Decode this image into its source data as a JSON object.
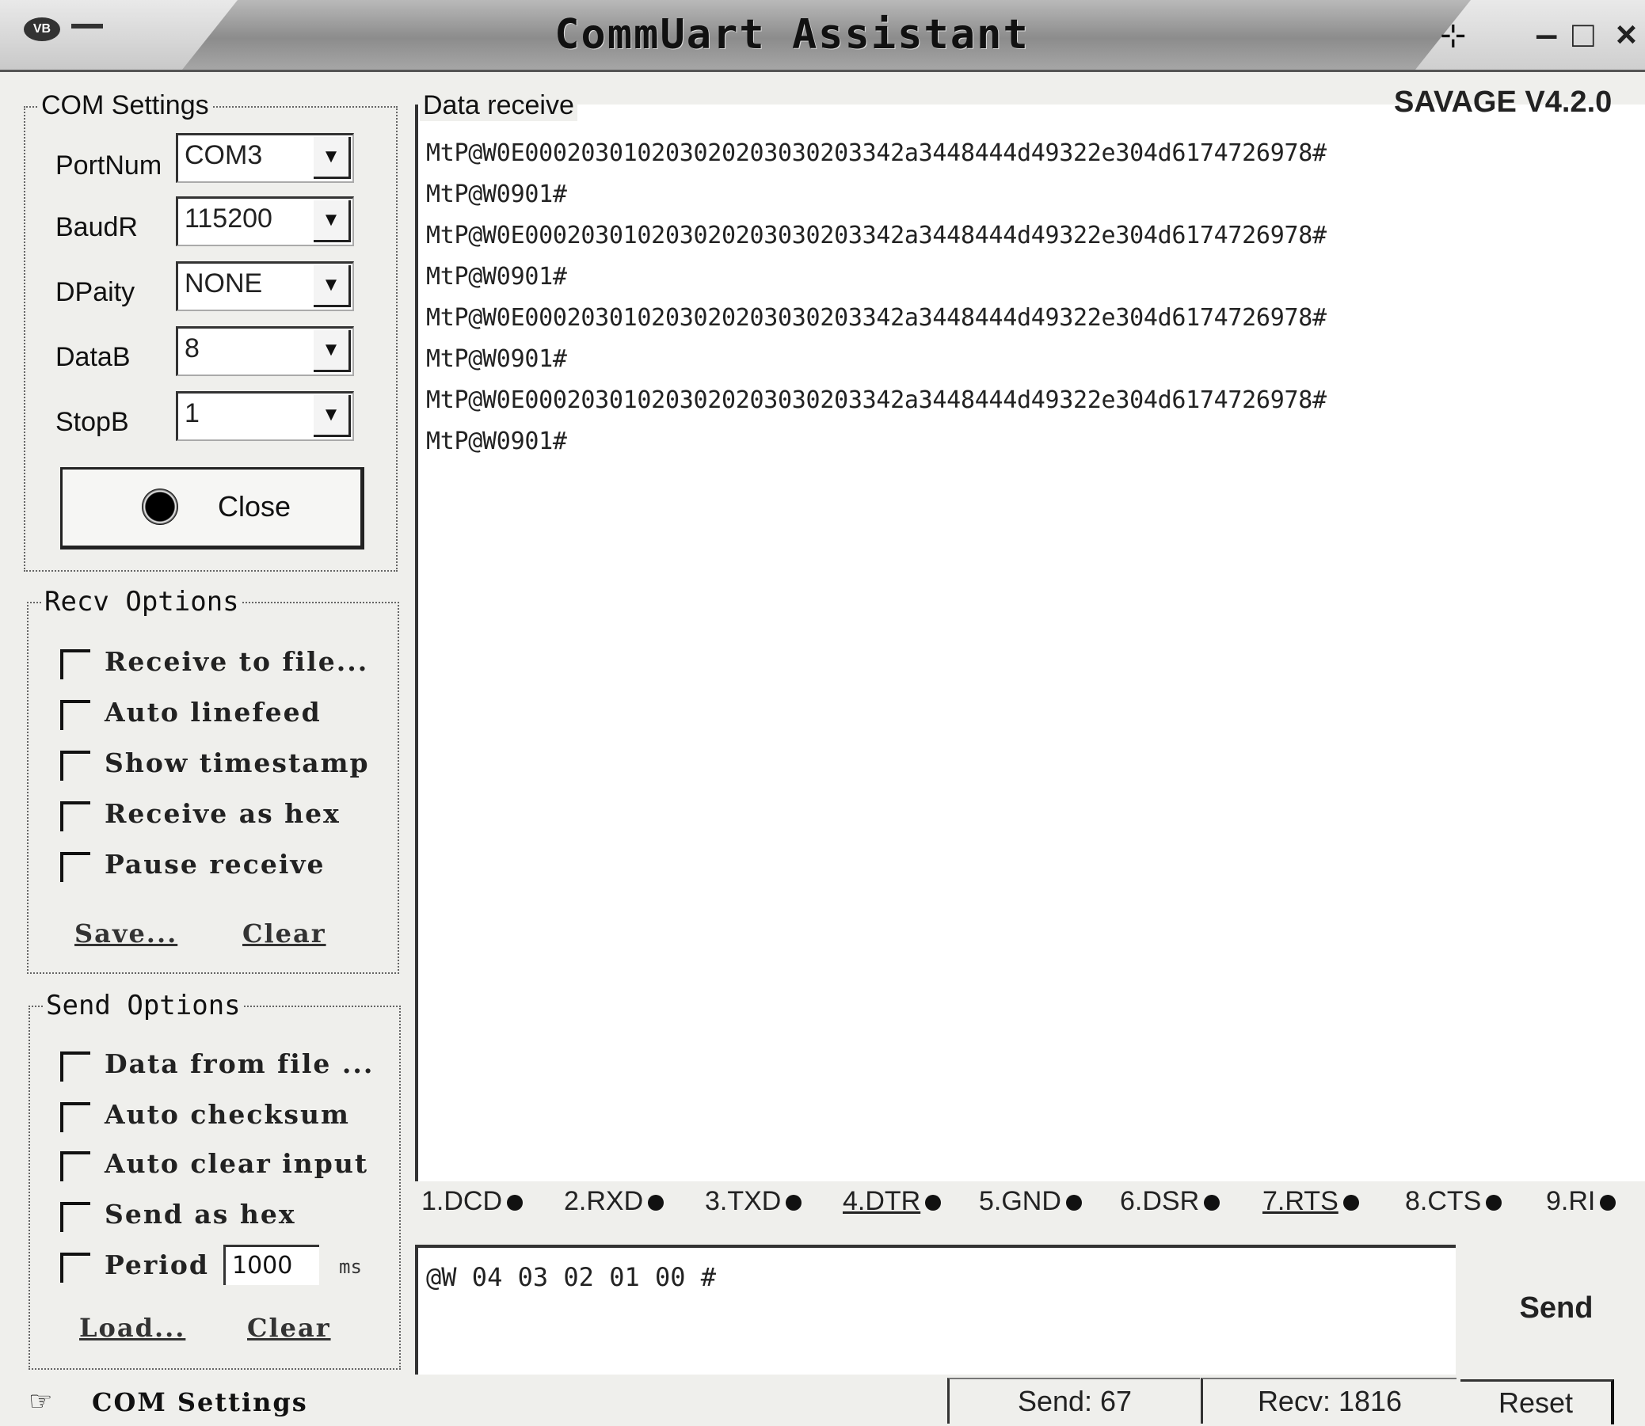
{
  "window": {
    "title": "CommUart Assistant",
    "version": "SAVAGE V4.2.0"
  },
  "com_settings": {
    "legend": "COM Settings",
    "fields": [
      {
        "label": "PortNum",
        "value": "COM3"
      },
      {
        "label": "BaudR",
        "value": "115200"
      },
      {
        "label": "DPaity",
        "value": "NONE"
      },
      {
        "label": "DataB",
        "value": "8"
      },
      {
        "label": "StopB",
        "value": "1"
      }
    ],
    "close_label": "Close"
  },
  "recv_options": {
    "legend": "Recv Options",
    "items": [
      "Receive to file...",
      "Auto linefeed",
      "Show timestamp",
      "Receive as hex",
      "Pause receive"
    ],
    "save_label": "Save...",
    "clear_label": "Clear"
  },
  "send_options": {
    "legend": "Send Options",
    "items": [
      "Data from file ...",
      "Auto checksum",
      "Auto clear input",
      "Send as hex"
    ],
    "period_label": "Period",
    "period_value": "1000",
    "period_unit": "ms",
    "load_label": "Load...",
    "clear_label": "Clear"
  },
  "data_receive": {
    "legend": "Data receive",
    "lines": [
      "MtP@W0E000203010203020203030203342a3448444d49322e304d6174726978#",
      "MtP@W0901#",
      "MtP@W0E000203010203020203030203342a3448444d49322e304d6174726978#",
      "MtP@W0901#",
      "MtP@W0E000203010203020203030203342a3448444d49322e304d6174726978#",
      "MtP@W0901#",
      "MtP@W0E000203010203020203030203342a3448444d49322e304d6174726978#",
      "MtP@W0901#"
    ]
  },
  "signals": [
    {
      "label": "1.DCD"
    },
    {
      "label": "2.RXD"
    },
    {
      "label": "3.TXD"
    },
    {
      "label": "4.DTR"
    },
    {
      "label": "5.GND"
    },
    {
      "label": "6.DSR"
    },
    {
      "label": "7.RTS"
    },
    {
      "label": "8.CTS"
    },
    {
      "label": "9.RI"
    }
  ],
  "send_area": {
    "text": "@W 04 03 02 01 00 #",
    "send_label": "Send"
  },
  "status_bar": {
    "label": "COM Settings",
    "send_count": "Send: 67",
    "recv_count": "Recv: 1816",
    "reset_label": "Reset"
  },
  "icons": {
    "system": "app-menu-icon",
    "pin": "pin-icon",
    "close_button": "sun-icon",
    "status": "settings-cursor-icon"
  }
}
